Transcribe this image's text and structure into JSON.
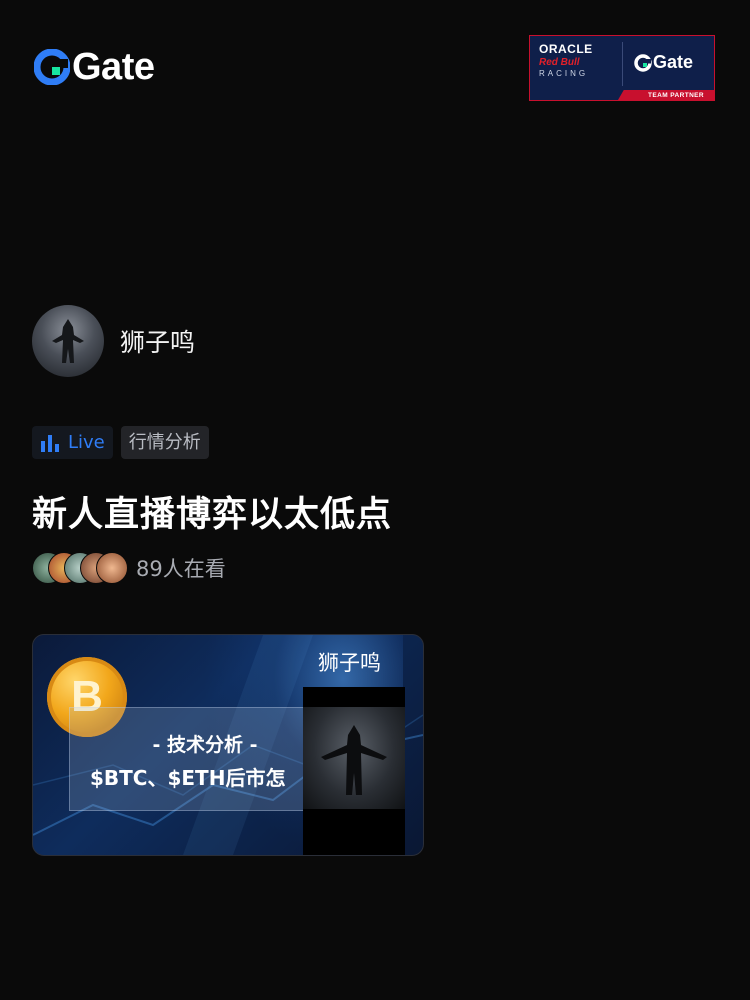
{
  "brand": {
    "logo_text": "Gate",
    "accent": "#2f7df6"
  },
  "partner_badge": {
    "oracle": "ORACLE",
    "redbull": "Red Bull",
    "racing": "RACING",
    "gate": "Gate",
    "label": "TEAM PARTNER"
  },
  "host": {
    "name": "狮子鸣"
  },
  "tags": {
    "live": "Live",
    "category": "行情分析"
  },
  "stream": {
    "title": "新人直播博弈以太低点"
  },
  "viewers": {
    "count_text": "89人在看"
  },
  "thumbnail": {
    "name": "狮子鸣",
    "coin_symbol": "B",
    "subtitle": "- 技术分析 -",
    "headline": "$BTC、$ETH后市怎"
  }
}
